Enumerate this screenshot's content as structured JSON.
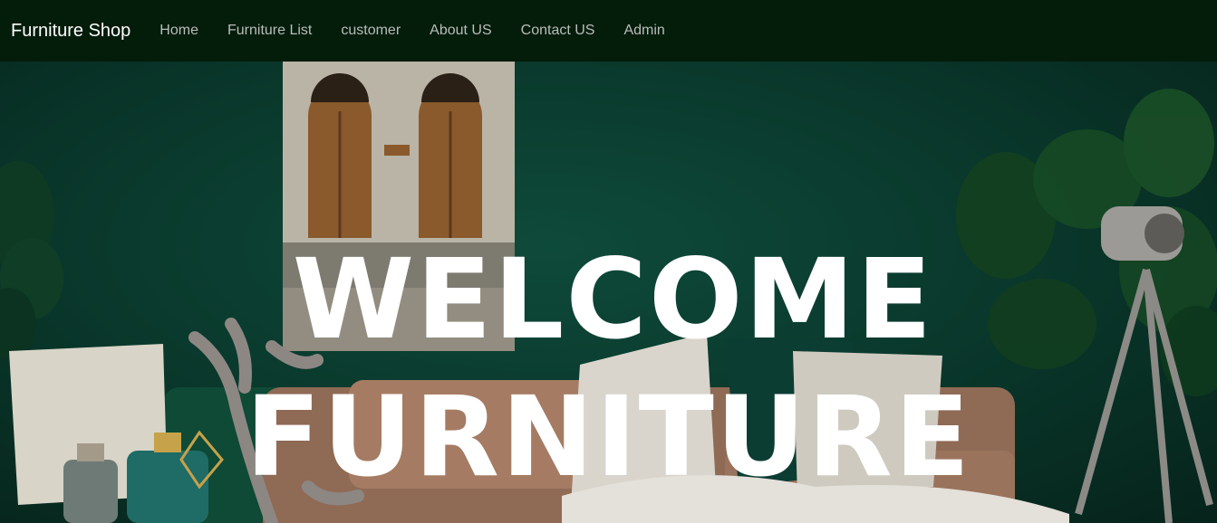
{
  "navbar": {
    "brand": "Furniture Shop",
    "links": [
      "Home",
      "Furniture List",
      "customer",
      "About US",
      "Contact US",
      "Admin"
    ]
  },
  "hero": {
    "title_line1": "WELCOME",
    "title_line2": "FURNITURE"
  },
  "colors": {
    "navbar_bg": "#041c0a",
    "wall": "#0a3a2d",
    "title": "#ffffff"
  }
}
